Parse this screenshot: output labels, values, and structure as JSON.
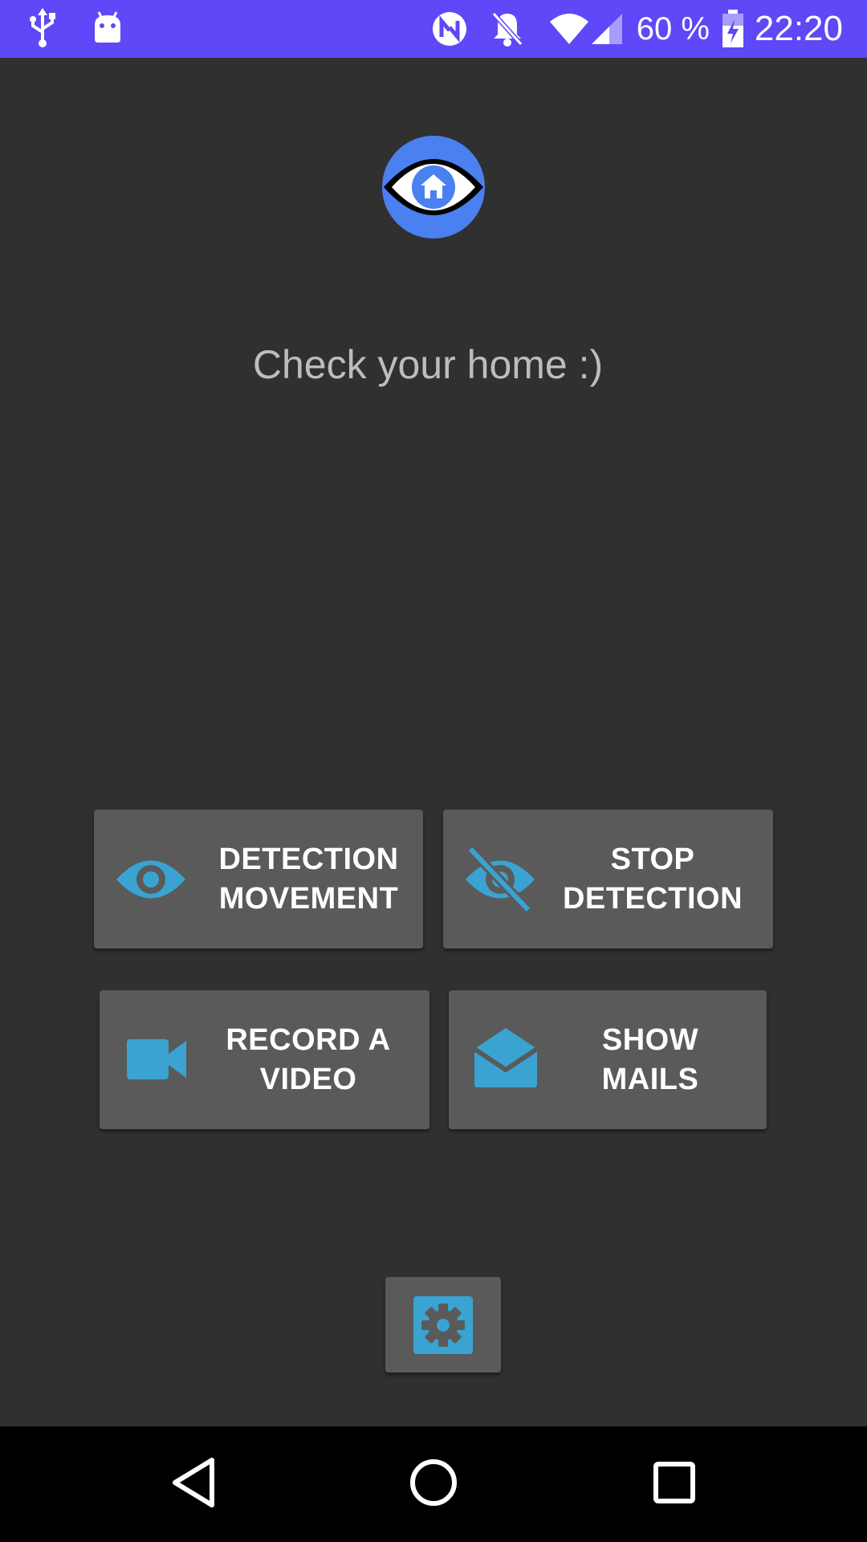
{
  "status_bar": {
    "battery_percent": "60 %",
    "time": "22:20",
    "background_color": "#5e48f7",
    "icons": [
      "usb-icon",
      "android-debug-icon",
      "nfc-icon",
      "notifications-off-icon",
      "wifi-icon",
      "signal-icon",
      "battery-charging-icon"
    ]
  },
  "app": {
    "logo_icon": "eye-home-logo",
    "tagline": "Check your home :)",
    "accent_color": "#3aa3d2"
  },
  "buttons": {
    "detection_movement": {
      "label": "DETECTION\nMOVEMENT",
      "icon": "eye-icon"
    },
    "stop_detection": {
      "label": "STOP\nDETECTION",
      "icon": "eye-off-icon"
    },
    "record_video": {
      "label": "RECORD A\nVIDEO",
      "icon": "videocam-icon"
    },
    "show_mails": {
      "label": "SHOW\nMAILS",
      "icon": "open-mail-icon"
    },
    "settings": {
      "icon": "settings-gear-icon"
    }
  },
  "nav_bar": {
    "buttons": [
      "back-icon",
      "home-icon",
      "recents-icon"
    ]
  }
}
